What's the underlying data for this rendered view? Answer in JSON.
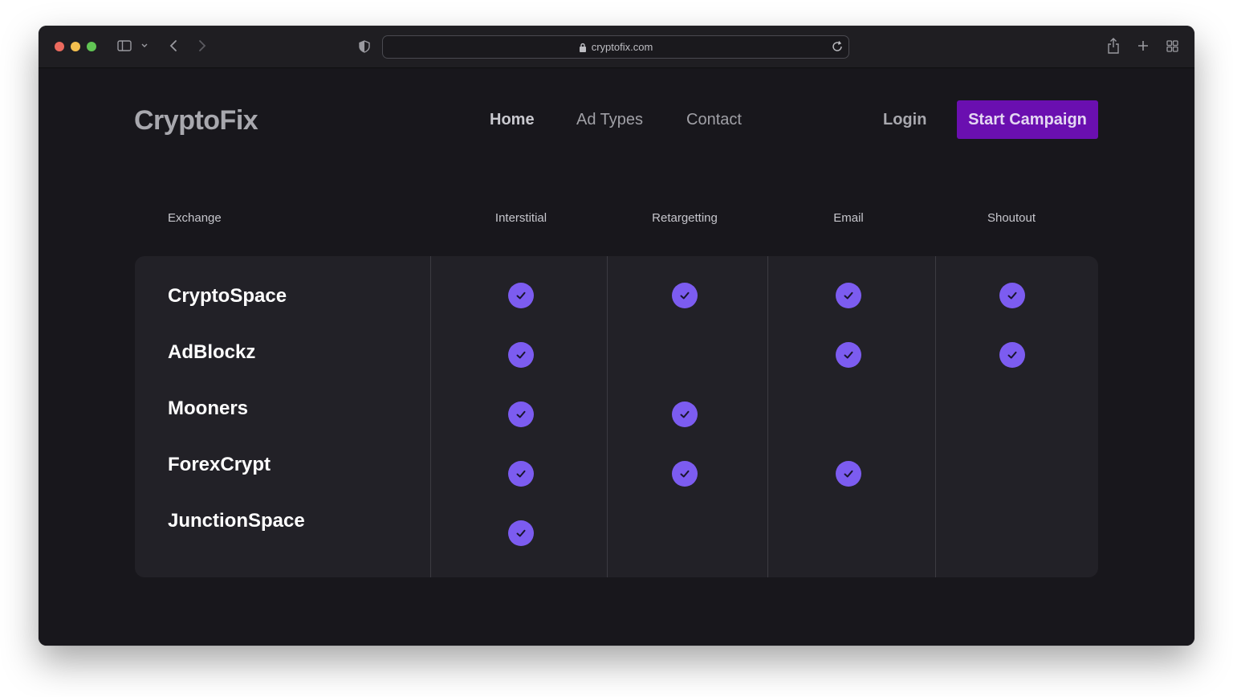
{
  "browser": {
    "url": "cryptofix.com"
  },
  "site": {
    "logo": "CryptoFix",
    "nav": {
      "home": "Home",
      "ad_types": "Ad Types",
      "contact": "Contact"
    },
    "login": "Login",
    "cta": "Start Campaign"
  },
  "table": {
    "columns": [
      "Exchange",
      "Interstitial",
      "Retargetting",
      "Email",
      "Shoutout"
    ],
    "rows": [
      {
        "name": "CryptoSpace",
        "supports": [
          true,
          true,
          true,
          true
        ]
      },
      {
        "name": "AdBlockz",
        "supports": [
          true,
          false,
          true,
          true
        ]
      },
      {
        "name": "Mooners",
        "supports": [
          true,
          true,
          false,
          false
        ]
      },
      {
        "name": "ForexCrypt",
        "supports": [
          true,
          true,
          true,
          false
        ]
      },
      {
        "name": "JunctionSpace",
        "supports": [
          true,
          false,
          false,
          false
        ]
      }
    ]
  },
  "colors": {
    "accent": "#6a0fb0",
    "check": "#7c5cf0",
    "background": "#18171c",
    "card": "#222127"
  },
  "icons": [
    "sidebar-icon",
    "chevron-down-icon",
    "back-icon",
    "forward-icon",
    "shield-icon",
    "lock-icon",
    "reload-icon",
    "share-icon",
    "plus-icon",
    "tabs-icon",
    "check-icon"
  ]
}
